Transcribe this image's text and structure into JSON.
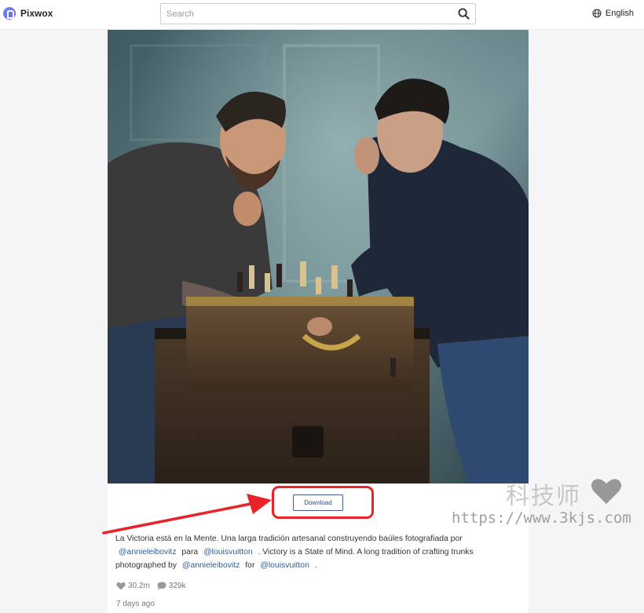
{
  "app": {
    "name": "Pixwox"
  },
  "search": {
    "placeholder": "Search",
    "value": ""
  },
  "language": {
    "label": "English"
  },
  "post": {
    "download_label": "Download",
    "caption": {
      "line1": "La Victoria está en la Mente. Una larga tradición artesanal construyendo baúles fotografiada por",
      "mention1": "@annieleibovitz",
      "para": "para",
      "mention2": "@louisvuitton",
      "line2_rest": ". Victory is a State of Mind. A long tradition of crafting trunks",
      "line3_start": "photographed by",
      "mention3": "@annieleibovitz",
      "for": "for",
      "mention4": "@louisvuitton",
      "end": "."
    },
    "likes": "30.2m",
    "comments": "329k",
    "time": "7 days ago"
  },
  "watermark": {
    "name": "科技师",
    "url": "https://www.3kjs.com"
  },
  "colors": {
    "accent": "#2f5d8e",
    "highlight": "#e8232a"
  },
  "icons": [
    "logo-icon",
    "search-icon",
    "globe-icon",
    "heart-icon",
    "comment-icon",
    "red-arrow"
  ]
}
